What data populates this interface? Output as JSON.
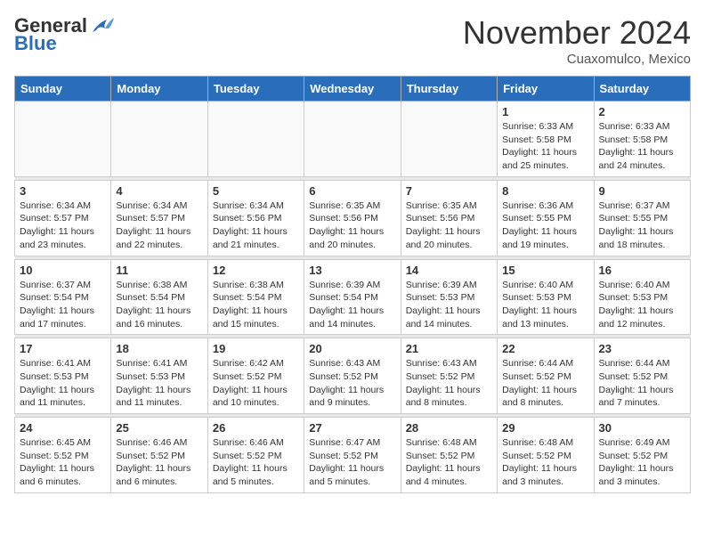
{
  "logo": {
    "general": "General",
    "blue": "Blue"
  },
  "title": "November 2024",
  "location": "Cuaxomulco, Mexico",
  "weekdays": [
    "Sunday",
    "Monday",
    "Tuesday",
    "Wednesday",
    "Thursday",
    "Friday",
    "Saturday"
  ],
  "weeks": [
    [
      {
        "day": "",
        "info": ""
      },
      {
        "day": "",
        "info": ""
      },
      {
        "day": "",
        "info": ""
      },
      {
        "day": "",
        "info": ""
      },
      {
        "day": "",
        "info": ""
      },
      {
        "day": "1",
        "info": "Sunrise: 6:33 AM\nSunset: 5:58 PM\nDaylight: 11 hours\nand 25 minutes."
      },
      {
        "day": "2",
        "info": "Sunrise: 6:33 AM\nSunset: 5:58 PM\nDaylight: 11 hours\nand 24 minutes."
      }
    ],
    [
      {
        "day": "3",
        "info": "Sunrise: 6:34 AM\nSunset: 5:57 PM\nDaylight: 11 hours\nand 23 minutes."
      },
      {
        "day": "4",
        "info": "Sunrise: 6:34 AM\nSunset: 5:57 PM\nDaylight: 11 hours\nand 22 minutes."
      },
      {
        "day": "5",
        "info": "Sunrise: 6:34 AM\nSunset: 5:56 PM\nDaylight: 11 hours\nand 21 minutes."
      },
      {
        "day": "6",
        "info": "Sunrise: 6:35 AM\nSunset: 5:56 PM\nDaylight: 11 hours\nand 20 minutes."
      },
      {
        "day": "7",
        "info": "Sunrise: 6:35 AM\nSunset: 5:56 PM\nDaylight: 11 hours\nand 20 minutes."
      },
      {
        "day": "8",
        "info": "Sunrise: 6:36 AM\nSunset: 5:55 PM\nDaylight: 11 hours\nand 19 minutes."
      },
      {
        "day": "9",
        "info": "Sunrise: 6:37 AM\nSunset: 5:55 PM\nDaylight: 11 hours\nand 18 minutes."
      }
    ],
    [
      {
        "day": "10",
        "info": "Sunrise: 6:37 AM\nSunset: 5:54 PM\nDaylight: 11 hours\nand 17 minutes."
      },
      {
        "day": "11",
        "info": "Sunrise: 6:38 AM\nSunset: 5:54 PM\nDaylight: 11 hours\nand 16 minutes."
      },
      {
        "day": "12",
        "info": "Sunrise: 6:38 AM\nSunset: 5:54 PM\nDaylight: 11 hours\nand 15 minutes."
      },
      {
        "day": "13",
        "info": "Sunrise: 6:39 AM\nSunset: 5:54 PM\nDaylight: 11 hours\nand 14 minutes."
      },
      {
        "day": "14",
        "info": "Sunrise: 6:39 AM\nSunset: 5:53 PM\nDaylight: 11 hours\nand 14 minutes."
      },
      {
        "day": "15",
        "info": "Sunrise: 6:40 AM\nSunset: 5:53 PM\nDaylight: 11 hours\nand 13 minutes."
      },
      {
        "day": "16",
        "info": "Sunrise: 6:40 AM\nSunset: 5:53 PM\nDaylight: 11 hours\nand 12 minutes."
      }
    ],
    [
      {
        "day": "17",
        "info": "Sunrise: 6:41 AM\nSunset: 5:53 PM\nDaylight: 11 hours\nand 11 minutes."
      },
      {
        "day": "18",
        "info": "Sunrise: 6:41 AM\nSunset: 5:53 PM\nDaylight: 11 hours\nand 11 minutes."
      },
      {
        "day": "19",
        "info": "Sunrise: 6:42 AM\nSunset: 5:52 PM\nDaylight: 11 hours\nand 10 minutes."
      },
      {
        "day": "20",
        "info": "Sunrise: 6:43 AM\nSunset: 5:52 PM\nDaylight: 11 hours\nand 9 minutes."
      },
      {
        "day": "21",
        "info": "Sunrise: 6:43 AM\nSunset: 5:52 PM\nDaylight: 11 hours\nand 8 minutes."
      },
      {
        "day": "22",
        "info": "Sunrise: 6:44 AM\nSunset: 5:52 PM\nDaylight: 11 hours\nand 8 minutes."
      },
      {
        "day": "23",
        "info": "Sunrise: 6:44 AM\nSunset: 5:52 PM\nDaylight: 11 hours\nand 7 minutes."
      }
    ],
    [
      {
        "day": "24",
        "info": "Sunrise: 6:45 AM\nSunset: 5:52 PM\nDaylight: 11 hours\nand 6 minutes."
      },
      {
        "day": "25",
        "info": "Sunrise: 6:46 AM\nSunset: 5:52 PM\nDaylight: 11 hours\nand 6 minutes."
      },
      {
        "day": "26",
        "info": "Sunrise: 6:46 AM\nSunset: 5:52 PM\nDaylight: 11 hours\nand 5 minutes."
      },
      {
        "day": "27",
        "info": "Sunrise: 6:47 AM\nSunset: 5:52 PM\nDaylight: 11 hours\nand 5 minutes."
      },
      {
        "day": "28",
        "info": "Sunrise: 6:48 AM\nSunset: 5:52 PM\nDaylight: 11 hours\nand 4 minutes."
      },
      {
        "day": "29",
        "info": "Sunrise: 6:48 AM\nSunset: 5:52 PM\nDaylight: 11 hours\nand 3 minutes."
      },
      {
        "day": "30",
        "info": "Sunrise: 6:49 AM\nSunset: 5:52 PM\nDaylight: 11 hours\nand 3 minutes."
      }
    ]
  ]
}
